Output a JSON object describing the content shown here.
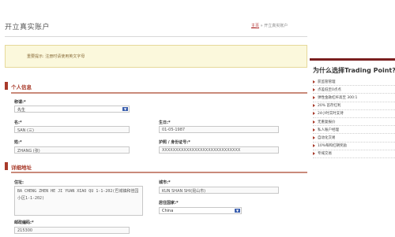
{
  "page": {
    "title": "开立真实账户",
    "breadcrumb": {
      "home": "主页",
      "separator": "»",
      "current": "开立真实账户"
    }
  },
  "notice": {
    "text": "重要提示: 注册时请使用英文字母"
  },
  "personal": {
    "section_title": "个人信息",
    "title_label": "称谓:*",
    "title_value": "先生",
    "first_name_label": "名:*",
    "first_name_value": "SAN (三)",
    "dob_label": "生日:*",
    "dob_value": "01-05-1987",
    "last_name_label": "姓:*",
    "last_name_value": "ZHANG (张)",
    "passport_label": "护照 / 身份证号:*",
    "passport_value": "XXXXXXXXXXXXXXXXXXXXXXXXXXXXX"
  },
  "address": {
    "section_title": "详细地址",
    "street_label": "住址:",
    "street_value": "BA CHENG ZHEN HE JI YUAN XIAO QU 1-1-202(巴城镇和佳园小区1-1-202)",
    "city_label": "城市:*",
    "city_value": "KUN SHAN SHI(昆山市)",
    "country_label": "居住国家:*",
    "country_value": "China",
    "postcode_label": "邮政编码:*",
    "postcode_value": "215300"
  },
  "sidebar": {
    "title": "为什么选择Trading Point?",
    "items": [
      "获监管管理",
      "点差低至0点点",
      "弹性金融杠杆高至 300:1",
      "20% 首存红利",
      "24小时实时支持",
      "无重复报价",
      "私人账户经理",
      "自动化交易",
      "10%每和红朝奖励",
      "专域交易"
    ]
  },
  "colors": {
    "accent": "#a83a2a",
    "notice_bg": "#fbf8dc",
    "sidebar_border": "#7a1f1f",
    "select_button": "#3b5fae"
  }
}
